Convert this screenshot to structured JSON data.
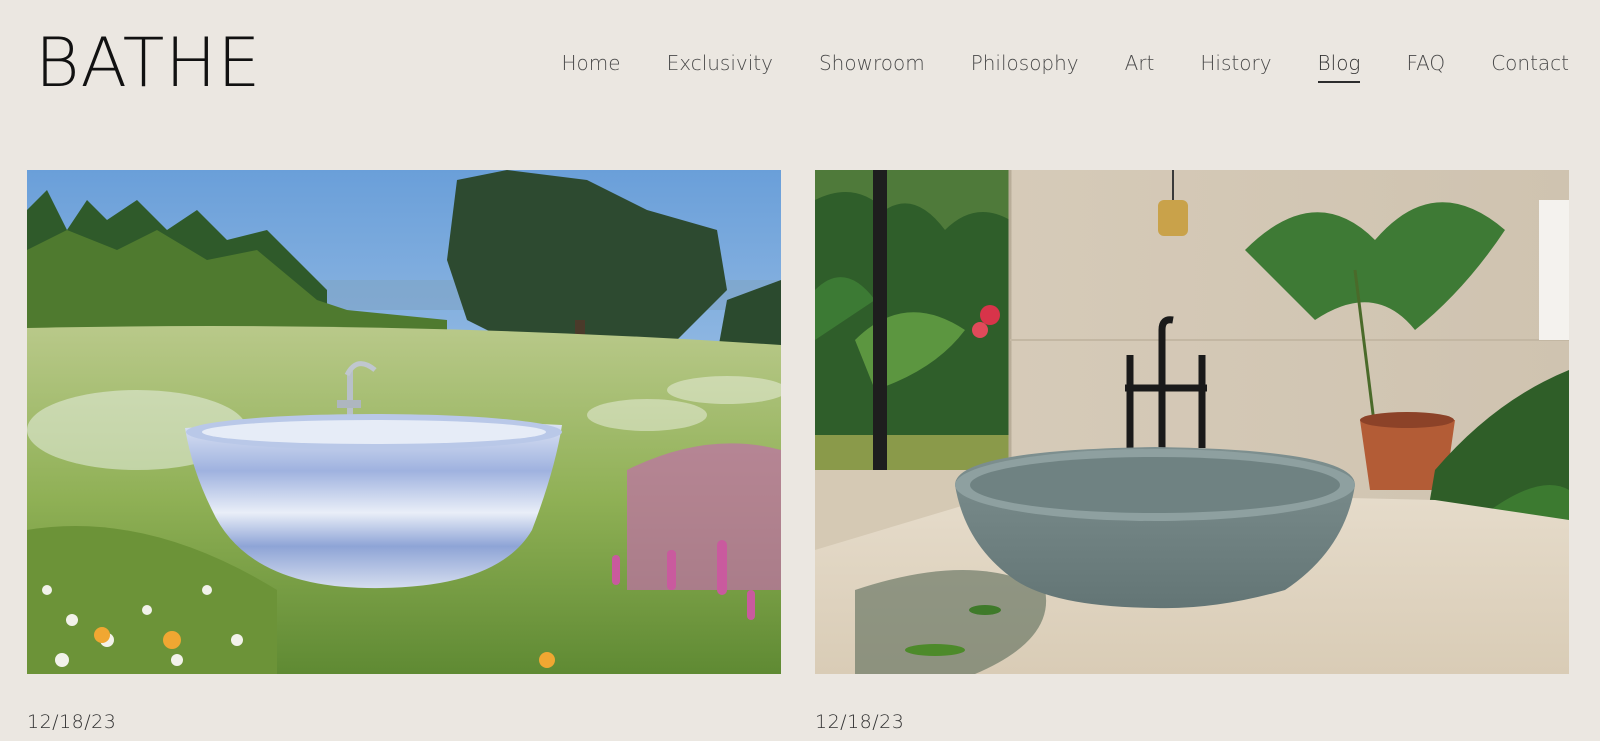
{
  "brand": {
    "logo_text": "BATHE"
  },
  "nav": {
    "items": [
      {
        "label": "Home",
        "active": false
      },
      {
        "label": "Exclusivity",
        "active": false
      },
      {
        "label": "Showroom",
        "active": false
      },
      {
        "label": "Philosophy",
        "active": false
      },
      {
        "label": "Art",
        "active": false
      },
      {
        "label": "History",
        "active": false
      },
      {
        "label": "Blog",
        "active": true
      },
      {
        "label": "FAQ",
        "active": false
      },
      {
        "label": "Contact",
        "active": false
      }
    ]
  },
  "posts": [
    {
      "date": "12/18/23"
    },
    {
      "date": "12/18/23"
    }
  ],
  "colors": {
    "background": "#ebe7e1",
    "text": "#2d2d2d"
  }
}
